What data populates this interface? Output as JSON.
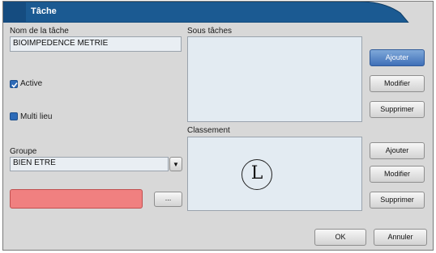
{
  "window": {
    "title": "Tâche"
  },
  "form": {
    "task_name_label": "Nom de la tâche",
    "task_name_value": "BIOIMPEDENCE METRIE",
    "active_label": "Active",
    "multi_lieu_label": "Multi lieu",
    "group_label": "Groupe",
    "group_value": "BIEN ETRE",
    "color_button_label": "...",
    "color": "#f08080"
  },
  "subtasks": {
    "label": "Sous tâches",
    "add_label": "Ajouter",
    "modify_label": "Modifier",
    "delete_label": "Supprimer"
  },
  "ranking": {
    "label": "Classement",
    "marker": "L",
    "add_label": "Ajouter",
    "modify_label": "Modifier",
    "delete_label": "Supprimer"
  },
  "footer": {
    "ok_label": "OK",
    "cancel_label": "Annuler"
  },
  "colors": {
    "title_bar": "#1b5a92",
    "primary_button": "#3f6fb8",
    "checkbox": "#2d6bb8"
  }
}
